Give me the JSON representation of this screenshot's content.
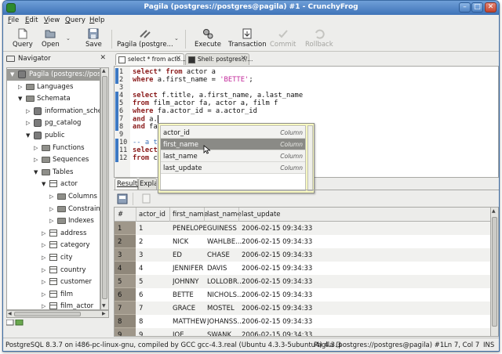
{
  "window": {
    "title": "Pagila (postgres://postgres@pagila) #1 - CrunchyFrog"
  },
  "menu": [
    {
      "pre": "",
      "key": "F",
      "post": "ile"
    },
    {
      "pre": "",
      "key": "E",
      "post": "dit"
    },
    {
      "pre": "",
      "key": "V",
      "post": "iew"
    },
    {
      "pre": "",
      "key": "Q",
      "post": "uery"
    },
    {
      "pre": "",
      "key": "H",
      "post": "elp"
    }
  ],
  "toolbar": {
    "query": "Query",
    "open": "Open",
    "save": "Save",
    "connection": "Pagila (postgre...",
    "execute": "Execute",
    "transaction": "Transaction",
    "commit": "Commit",
    "rollback": "Rollback"
  },
  "navigator": {
    "title": "Navigator",
    "tree": [
      {
        "label": "Pagila (postgres://postgres",
        "kind": "db",
        "expanded": true,
        "selected": true
      },
      {
        "label": "Languages",
        "kind": "folder",
        "expanded": false
      },
      {
        "label": "Schemata",
        "kind": "folder",
        "expanded": true
      },
      {
        "label": "information_schema",
        "kind": "db",
        "expanded": false
      },
      {
        "label": "pg_catalog",
        "kind": "db",
        "expanded": false
      },
      {
        "label": "public",
        "kind": "db",
        "expanded": true
      },
      {
        "label": "Functions",
        "kind": "folder",
        "expanded": false
      },
      {
        "label": "Sequences",
        "kind": "folder",
        "expanded": false
      },
      {
        "label": "Tables",
        "kind": "folder",
        "expanded": true
      },
      {
        "label": "actor",
        "kind": "table",
        "expanded": true
      },
      {
        "label": "Columns",
        "kind": "folder",
        "expanded": false
      },
      {
        "label": "Constraints",
        "kind": "folder",
        "expanded": false
      },
      {
        "label": "Indexes",
        "kind": "folder",
        "expanded": false
      },
      {
        "label": "address",
        "kind": "table",
        "expanded": false
      },
      {
        "label": "category",
        "kind": "table",
        "expanded": false
      },
      {
        "label": "city",
        "kind": "table",
        "expanded": false
      },
      {
        "label": "country",
        "kind": "table",
        "expanded": false
      },
      {
        "label": "customer",
        "kind": "table",
        "expanded": false
      },
      {
        "label": "film",
        "kind": "table",
        "expanded": false
      },
      {
        "label": "film_actor",
        "kind": "table",
        "expanded": false
      }
    ]
  },
  "editor_tabs": [
    {
      "label": "select * from acto..."
    },
    {
      "label": "Shell: postgres://..."
    }
  ],
  "editor_lines": [
    {
      "n": "1",
      "parts": [
        [
          "kw",
          "select"
        ],
        [
          "",
          "* "
        ],
        [
          "kw",
          "from"
        ],
        [
          "",
          " actor a"
        ]
      ]
    },
    {
      "n": "2",
      "parts": [
        [
          "kw",
          "where"
        ],
        [
          "",
          " a.first_name = "
        ],
        [
          "str",
          "'BETTE'"
        ],
        [
          "",
          ";"
        ]
      ]
    },
    {
      "n": "3",
      "parts": []
    },
    {
      "n": "4",
      "parts": [
        [
          "kw",
          "select"
        ],
        [
          "",
          " f.title, a.first_name, a.last_name"
        ]
      ]
    },
    {
      "n": "5",
      "parts": [
        [
          "kw",
          "from"
        ],
        [
          "",
          " film_actor fa, actor a, film f"
        ]
      ]
    },
    {
      "n": "6",
      "parts": [
        [
          "kw",
          "where"
        ],
        [
          "",
          " fa.actor_id = a.actor_id"
        ]
      ]
    },
    {
      "n": "7",
      "parts": [
        [
          "kw",
          "and"
        ],
        [
          "",
          " a."
        ]
      ],
      "cursor": true
    },
    {
      "n": "8",
      "parts": [
        [
          "kw",
          "and"
        ],
        [
          "",
          " fa"
        ]
      ]
    },
    {
      "n": "9",
      "parts": []
    },
    {
      "n": "10",
      "parts": [
        [
          "cmt",
          "-- a t"
        ]
      ]
    },
    {
      "n": "11",
      "parts": [
        [
          "kw",
          "select"
        ]
      ]
    },
    {
      "n": "12",
      "parts": [
        [
          "kw",
          "from"
        ],
        [
          "",
          " c"
        ]
      ]
    }
  ],
  "autocomplete": [
    {
      "name": "actor_id",
      "type": "Column"
    },
    {
      "name": "first_name",
      "type": "Column"
    },
    {
      "name": "last_name",
      "type": "Column"
    },
    {
      "name": "last_update",
      "type": "Column"
    }
  ],
  "results": {
    "tabs": [
      "Results",
      "Explai"
    ],
    "columns": [
      "#",
      "actor_id",
      "first_name",
      "last_name",
      "last_update"
    ],
    "rows": [
      [
        "1",
        "1",
        "PENELOPE",
        "GUINESS",
        "2006-02-15 09:34:33"
      ],
      [
        "2",
        "2",
        "NICK",
        "WAHLBE...",
        "2006-02-15 09:34:33"
      ],
      [
        "3",
        "3",
        "ED",
        "CHASE",
        "2006-02-15 09:34:33"
      ],
      [
        "4",
        "4",
        "JENNIFER",
        "DAVIS",
        "2006-02-15 09:34:33"
      ],
      [
        "5",
        "5",
        "JOHNNY",
        "LOLLOBR...",
        "2006-02-15 09:34:33"
      ],
      [
        "6",
        "6",
        "BETTE",
        "NICHOLS...",
        "2006-02-15 09:34:33"
      ],
      [
        "7",
        "7",
        "GRACE",
        "MOSTEL",
        "2006-02-15 09:34:33"
      ],
      [
        "8",
        "8",
        "MATTHEW",
        "JOHANSS...",
        "2006-02-15 09:34:33"
      ],
      [
        "9",
        "9",
        "JOE",
        "SWANK",
        "2006-02-15 09:34:33"
      ]
    ]
  },
  "status": {
    "left": "PostgreSQL 8.3.7 on i486-pc-linux-gnu, compiled by GCC gcc-4.3.real (Ubuntu 4.3.3-5ubuntu4) 4.3.3",
    "connection": "Pagila (postgres://postgres@pagila) #1",
    "position": "Ln 7, Col 7",
    "mode": "INS"
  },
  "colors": {
    "title_bar": "#4a7dc0",
    "keyword": "#8a1a1a",
    "string": "#c2279a",
    "comment": "#3f74b8",
    "autocomplete_bg": "#f7f8c0"
  }
}
